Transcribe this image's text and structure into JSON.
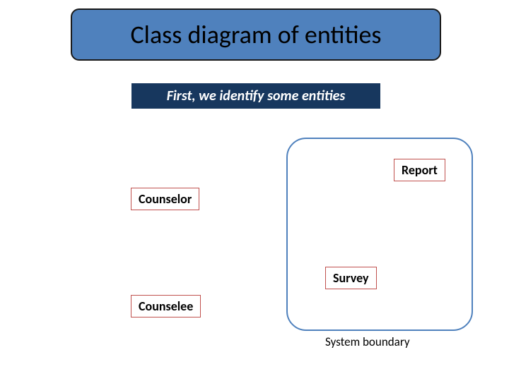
{
  "title": "Class diagram of entities",
  "subtitle": "First, we identify some entities",
  "entities": {
    "report": "Report",
    "counselor": "Counselor",
    "survey": "Survey",
    "counselee": "Counselee"
  },
  "boundary_label": "System boundary"
}
